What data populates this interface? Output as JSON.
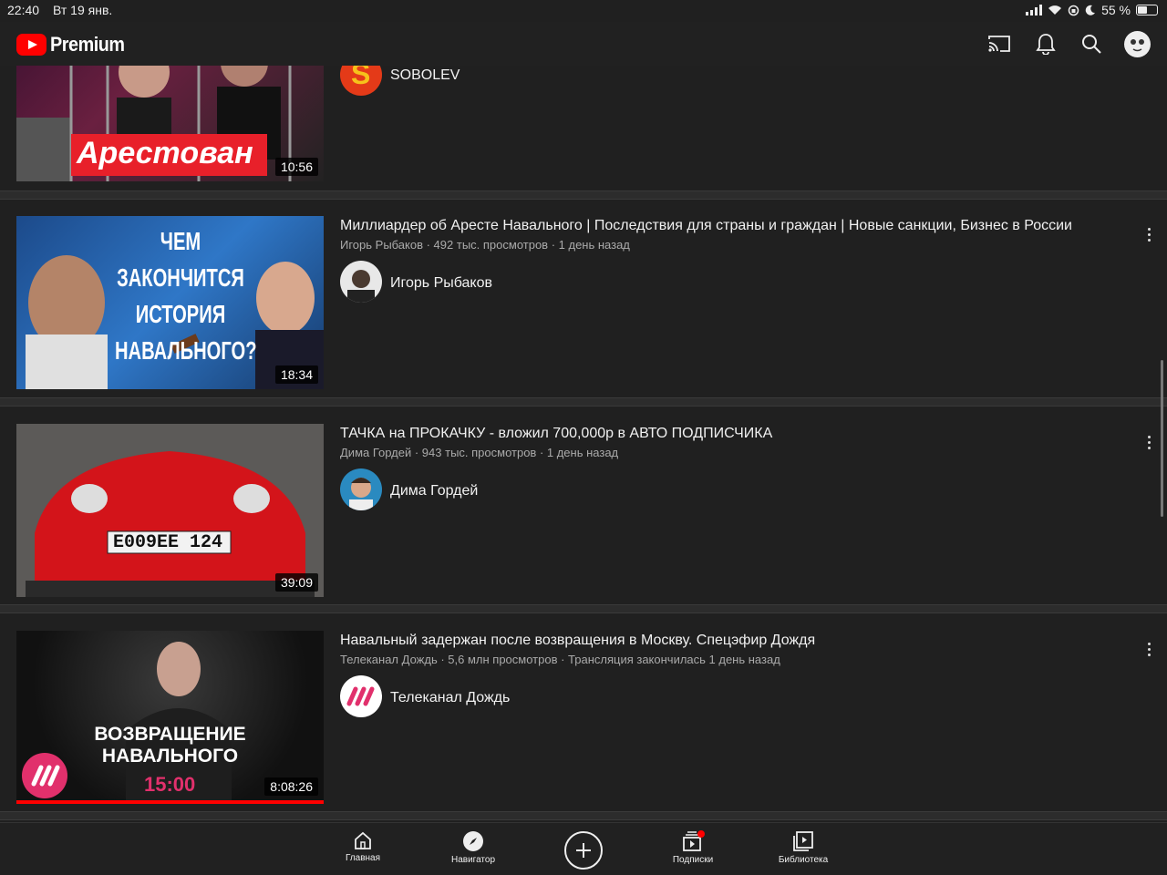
{
  "status_bar": {
    "time": "22:40",
    "date": "Вт 19 янв.",
    "battery": "55 %",
    "battery_level": 0.55
  },
  "app_bar": {
    "logo_text": "Premium",
    "icons": [
      "cast-icon",
      "bell-icon",
      "search-icon",
      "account-avatar"
    ]
  },
  "videos": [
    {
      "title": "",
      "thumb_text": "Арестован",
      "duration": "10:56",
      "channel": "SOBOLEV",
      "channel_avatar_letter": "S"
    },
    {
      "title": "Миллиардер об Аресте Навального | Последствия для страны и граждан | Новые санкции, Бизнес в России",
      "meta": "Игорь Рыбаков · 492 тыс. просмотров · 1 день назад",
      "thumb_text": "ЧЕМ ЗАКОНЧИТСЯ ИСТОРИЯ НАВАЛЬНОГО?",
      "duration": "18:34",
      "channel": "Игорь Рыбаков"
    },
    {
      "title": "ТАЧКА на ПРОКАЧКУ - вложил 700,000р в АВТО ПОДПИСЧИКА",
      "meta": "Дима Гордей · 943 тыс. просмотров · 1 день назад",
      "thumb_text": "E009EE 124",
      "duration": "39:09",
      "channel": "Дима Гордей"
    },
    {
      "title": "Навальный задержан после возвращения в Москву. Спецэфир Дождя",
      "meta": "Телеканал Дождь · 5,6 млн просмотров · Трансляция закончилась 1 день назад",
      "thumb_text_line1": "ВОЗВРАЩЕНИЕ",
      "thumb_text_line2": "НАВАЛЬНОГО",
      "thumb_time": "15:00",
      "duration": "8:08:26",
      "channel": "Телеканал Дождь",
      "watched_progress": 1.0
    }
  ],
  "bottom_nav": {
    "home": "Главная",
    "explore": "Навигатор",
    "subscriptions": "Подписки",
    "library": "Библиотека"
  },
  "colors": {
    "background": "#202020",
    "accent_red": "#ff0000",
    "dozhd_pink": "#e1306c"
  }
}
